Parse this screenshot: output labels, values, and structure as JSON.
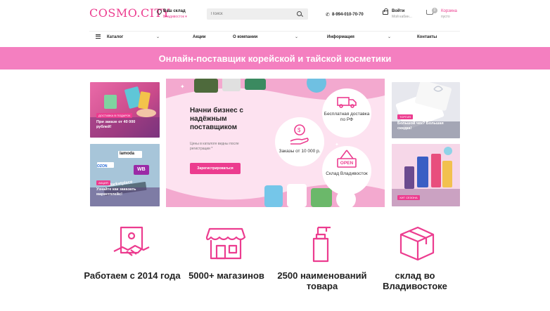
{
  "header": {
    "logo": "COSMO.CITY",
    "stock_title": "Ваш склад",
    "stock_city": "Владивосток ▾",
    "search_placeholder": "Поиск",
    "phone": "8-994-010-70-70",
    "login_title": "Войти",
    "login_sub": "Мой кабин...",
    "cart_count": "0",
    "cart_title": "Корзина",
    "cart_sub": "пусто"
  },
  "nav": {
    "catalog": "Каталог",
    "actions": "Акции",
    "about": "О компании",
    "info": "Информация",
    "contacts": "Контакты"
  },
  "banner": {
    "text": "Онлайн-поставщик корейской и тайской косметики"
  },
  "tiles": {
    "left_top_tag": "ДОСТАВКА В ПОДАРОК",
    "left_top_text": "При заказе от 40 000 рублей!",
    "left_bottom_tag": "АКЦИЯ",
    "left_bottom_text": "Узнайте как заказать маркетплейс!",
    "left_bottom_brand1": "OZON",
    "left_bottom_brand2": "lamoda",
    "left_bottom_brand3": "WB",
    "left_bottom_brand4": "Marketplace",
    "right_top_tag": "ТОРГИЯ",
    "right_top_text": "Большой чек? Большая скидка!",
    "right_bottom_tag": "ХИТ СЕЗОНА"
  },
  "hero": {
    "title": "Начни бизнес с надёжным поставщиком",
    "subtitle": "Цены в каталоге видны после регистрации *",
    "button": "Зарегистрироваться",
    "delivery": "Бесплатная доставка по РФ",
    "orders": "Заказы от 10 000 р.",
    "open_sign": "OPEN",
    "warehouse": "Склад Владивосток"
  },
  "features": [
    {
      "icon": "handshake-icon",
      "text": "Работаем с 2014 года"
    },
    {
      "icon": "store-icon",
      "text": "5000+ магазинов"
    },
    {
      "icon": "bottle-icon",
      "text": "2500 наименований товара"
    },
    {
      "icon": "box-icon",
      "text": "склад во Владивостоке"
    }
  ],
  "colors": {
    "brand_pink": "#ec3c8f",
    "banner_pink": "#f47fc0"
  }
}
